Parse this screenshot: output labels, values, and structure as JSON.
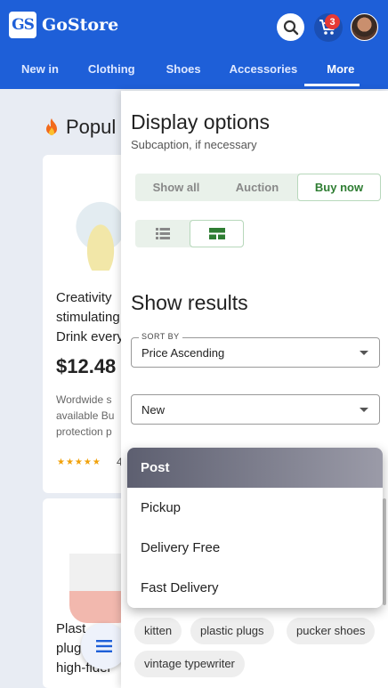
{
  "header": {
    "logo_mark": "GS",
    "brand": "GoStore",
    "cart_count": "3",
    "nav": [
      {
        "label": "New in"
      },
      {
        "label": "Clothing"
      },
      {
        "label": "Shoes"
      },
      {
        "label": "Accessories"
      },
      {
        "label": "More"
      }
    ]
  },
  "background": {
    "section_title": "Popul",
    "product1": {
      "desc_lines": [
        "Creativity",
        "stimulating",
        "Drink every"
      ],
      "price": "$12.48",
      "small_lines": [
        "Wordwide s",
        "available Bu",
        "protection p"
      ],
      "stars": "★★★★★",
      "rating": "4"
    },
    "product2": {
      "desc_lines": [
        "Plast",
        "plug",
        "high-fidel"
      ]
    }
  },
  "drawer": {
    "title": "Display options",
    "subtitle": "Subcaption, if necessary",
    "segments": [
      "Show all",
      "Auction",
      "Buy now"
    ],
    "results_title": "Show results",
    "sort_label": "SORT BY",
    "sort_value": "Price Ascending",
    "condition_value": "New",
    "menu_items": [
      "Post",
      "Pickup",
      "Delivery Free",
      "Fast Delivery"
    ],
    "chips": [
      "kitten",
      "plastic plugs",
      "pucker shoes",
      "vintage typewriter"
    ]
  },
  "colors": {
    "brand_blue": "#1e5fd8",
    "accent_green": "#2e7d32",
    "badge_red": "#e53935"
  },
  "icons": [
    "search-icon",
    "cart-icon",
    "list-view-icon",
    "grid-view-icon",
    "menu-icon",
    "fire-icon"
  ]
}
